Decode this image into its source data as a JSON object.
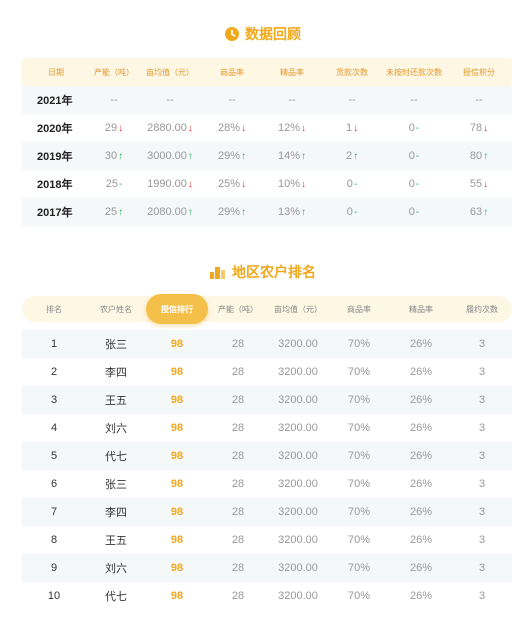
{
  "review": {
    "title": "数据回顾",
    "headers": [
      "日期",
      "产能（吨）",
      "亩均值（元）",
      "商品率",
      "精品率",
      "货款次数",
      "未按时还款次数",
      "授信积分"
    ],
    "rows": [
      {
        "year": "2021年",
        "cells": [
          {
            "v": "--",
            "t": "none"
          },
          {
            "v": "--",
            "t": "none"
          },
          {
            "v": "--",
            "t": "none"
          },
          {
            "v": "--",
            "t": "none"
          },
          {
            "v": "--",
            "t": "none"
          },
          {
            "v": "--",
            "t": "none"
          },
          {
            "v": "--",
            "t": "none"
          }
        ]
      },
      {
        "year": "2020年",
        "cells": [
          {
            "v": "29",
            "t": "down"
          },
          {
            "v": "2880.00",
            "t": "down"
          },
          {
            "v": "28%",
            "t": "down"
          },
          {
            "v": "12%",
            "t": "down"
          },
          {
            "v": "1",
            "t": "down"
          },
          {
            "v": "0",
            "t": "flat"
          },
          {
            "v": "78",
            "t": "down"
          }
        ]
      },
      {
        "year": "2019年",
        "cells": [
          {
            "v": "30",
            "t": "up"
          },
          {
            "v": "3000.00",
            "t": "up"
          },
          {
            "v": "29%",
            "t": "up"
          },
          {
            "v": "14%",
            "t": "up"
          },
          {
            "v": "2",
            "t": "up"
          },
          {
            "v": "0",
            "t": "flat"
          },
          {
            "v": "80",
            "t": "up"
          }
        ]
      },
      {
        "year": "2018年",
        "cells": [
          {
            "v": "25",
            "t": "flat"
          },
          {
            "v": "1990.00",
            "t": "down"
          },
          {
            "v": "25%",
            "t": "down"
          },
          {
            "v": "10%",
            "t": "down"
          },
          {
            "v": "0",
            "t": "flat"
          },
          {
            "v": "0",
            "t": "flat"
          },
          {
            "v": "55",
            "t": "down"
          }
        ]
      },
      {
        "year": "2017年",
        "cells": [
          {
            "v": "25",
            "t": "up"
          },
          {
            "v": "2080.00",
            "t": "up"
          },
          {
            "v": "29%",
            "t": "up"
          },
          {
            "v": "13%",
            "t": "up"
          },
          {
            "v": "0",
            "t": "flat"
          },
          {
            "v": "0",
            "t": "flat"
          },
          {
            "v": "63",
            "t": "up"
          }
        ]
      }
    ],
    "arrows": {
      "up": "↑",
      "down": "↓",
      "flat": "-",
      "none": ""
    }
  },
  "ranking": {
    "title": "地区农户排名",
    "headers": [
      "排名",
      "农户姓名",
      "授信排行",
      "产能（吨）",
      "亩均值（元）",
      "商品率",
      "精品率",
      "履约次数"
    ],
    "active_header_index": 2,
    "rows": [
      [
        "1",
        "张三",
        "98",
        "28",
        "3200.00",
        "70%",
        "26%",
        "3"
      ],
      [
        "2",
        "李四",
        "98",
        "28",
        "3200.00",
        "70%",
        "26%",
        "3"
      ],
      [
        "3",
        "王五",
        "98",
        "28",
        "3200.00",
        "70%",
        "26%",
        "3"
      ],
      [
        "4",
        "刘六",
        "98",
        "28",
        "3200.00",
        "70%",
        "26%",
        "3"
      ],
      [
        "5",
        "代七",
        "98",
        "28",
        "3200.00",
        "70%",
        "26%",
        "3"
      ],
      [
        "6",
        "张三",
        "98",
        "28",
        "3200.00",
        "70%",
        "26%",
        "3"
      ],
      [
        "7",
        "李四",
        "98",
        "28",
        "3200.00",
        "70%",
        "26%",
        "3"
      ],
      [
        "8",
        "王五",
        "98",
        "28",
        "3200.00",
        "70%",
        "26%",
        "3"
      ],
      [
        "9",
        "刘六",
        "98",
        "28",
        "3200.00",
        "70%",
        "26%",
        "3"
      ],
      [
        "10",
        "代七",
        "98",
        "28",
        "3200.00",
        "70%",
        "26%",
        "3"
      ]
    ]
  },
  "colors": {
    "accent": "#f0a81c",
    "up": "#25b36c",
    "down": "#e3342f",
    "header_bg": "#fef7e4",
    "stripe": "#f5f8f8"
  }
}
